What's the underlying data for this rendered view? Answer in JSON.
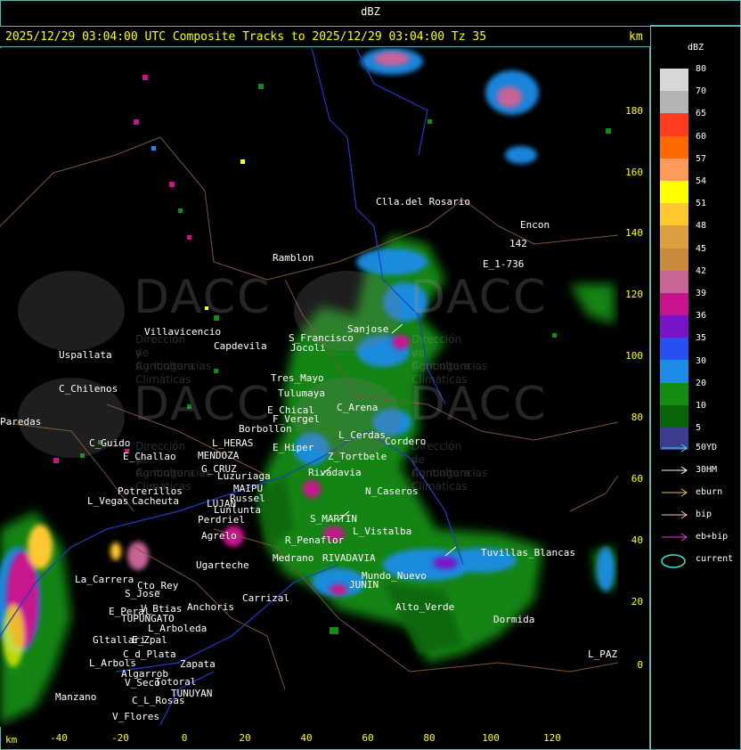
{
  "top_bar": {
    "title": "dBZ"
  },
  "header": {
    "text": "2025/12/29 03:04:00 UTC Composite Tracks to 2025/12/29 03:04:00 Tz 35",
    "unit": "km"
  },
  "axes": {
    "y_ticks": [
      "180",
      "160",
      "140",
      "120",
      "100",
      "80",
      "60",
      "40",
      "20",
      "0"
    ],
    "x_ticks": [
      "-40",
      "-20",
      "0",
      "20",
      "40",
      "60",
      "80",
      "100",
      "120"
    ],
    "x_unit": "km"
  },
  "legend": {
    "title": "dBZ",
    "scale": [
      {
        "label": "80",
        "color": "#d8d8d8"
      },
      {
        "label": "70",
        "color": "#b4b4b4"
      },
      {
        "label": "65",
        "color": "#ff3c1e"
      },
      {
        "label": "60",
        "color": "#ff6a00"
      },
      {
        "label": "57",
        "color": "#ff9a5a"
      },
      {
        "label": "54",
        "color": "#ffff00"
      },
      {
        "label": "51",
        "color": "#ffc830"
      },
      {
        "label": "48",
        "color": "#dca040"
      },
      {
        "label": "45",
        "color": "#c88c3c"
      },
      {
        "label": "42",
        "color": "#c86496"
      },
      {
        "label": "39",
        "color": "#c8148c"
      },
      {
        "label": "36",
        "color": "#7814c8"
      },
      {
        "label": "35",
        "color": "#2850f0"
      },
      {
        "label": "30",
        "color": "#1e8ce6"
      },
      {
        "label": "20",
        "color": "#148c14"
      },
      {
        "label": "10",
        "color": "#0a640a"
      },
      {
        "label": "5",
        "color": "#3c3c8c"
      }
    ],
    "tracks": [
      {
        "label": "50YD",
        "color": "#40e0e0"
      },
      {
        "label": "30HM",
        "color": "#ffffff"
      },
      {
        "label": "eburn",
        "color": "#e8c070"
      },
      {
        "label": "bip",
        "color": "#ffc0c0"
      },
      {
        "label": "eb+bip",
        "color": "#e040e0"
      },
      {
        "label": "current",
        "color": "#40e0e0"
      }
    ]
  },
  "watermark": {
    "brand": "DACC",
    "line1": "Dirección de Agricultura",
    "line2": "y Contingencias Climáticas"
  },
  "places": [
    {
      "name": "Clla.del Rosario"
    },
    {
      "name": "Encon"
    },
    {
      "name": "142"
    },
    {
      "name": "Ramblon"
    },
    {
      "name": "E_1-736"
    },
    {
      "name": "Villavicencio"
    },
    {
      "name": "Capdevila"
    },
    {
      "name": "S_Francisco"
    },
    {
      "name": "Jocoli"
    },
    {
      "name": "Sanjose"
    },
    {
      "name": "Uspallata"
    },
    {
      "name": "Tres_Mayo"
    },
    {
      "name": "Tulumaya"
    },
    {
      "name": "C_Chilenos"
    },
    {
      "name": "E_Chical"
    },
    {
      "name": "C_Arena"
    },
    {
      "name": "F_Vergel"
    },
    {
      "name": "Borbollon"
    },
    {
      "name": "L_Cerdas"
    },
    {
      "name": "Paredas"
    },
    {
      "name": "C_Guido"
    },
    {
      "name": "L_HERAS"
    },
    {
      "name": "E_Hiper"
    },
    {
      "name": "Z_Tortbele"
    },
    {
      "name": "Cordero"
    },
    {
      "name": "E_Challao"
    },
    {
      "name": "MENDOZA"
    },
    {
      "name": "G_CRUZ"
    },
    {
      "name": "Luzuriaga"
    },
    {
      "name": "Rivadavia"
    },
    {
      "name": "MAIPU"
    },
    {
      "name": "Russel"
    },
    {
      "name": "N_Caseros"
    },
    {
      "name": "Potrerillos"
    },
    {
      "name": "L_Vegas"
    },
    {
      "name": "Cacheuta"
    },
    {
      "name": "LUJAN"
    },
    {
      "name": "Lunlunta"
    },
    {
      "name": "S_MARTIN"
    },
    {
      "name": "Perdriel"
    },
    {
      "name": "Agrelo"
    },
    {
      "name": "L_Vistalba"
    },
    {
      "name": "R_Penaflor"
    },
    {
      "name": "Ugarteche"
    },
    {
      "name": "Medrano"
    },
    {
      "name": "RIVADAVIA"
    },
    {
      "name": "JUNIN"
    },
    {
      "name": "Mundo_Nuevo"
    },
    {
      "name": "Tuvillas_Blancas"
    },
    {
      "name": "La_Carrera"
    },
    {
      "name": "Cto_Rey"
    },
    {
      "name": "S_Jose"
    },
    {
      "name": "Carrizal"
    },
    {
      "name": "Alto_Verde"
    },
    {
      "name": "Anchoris"
    },
    {
      "name": "E_Peral"
    },
    {
      "name": "V_Btias"
    },
    {
      "name": "TUPUNGATO"
    },
    {
      "name": "L_Arboleda"
    },
    {
      "name": "Dormida"
    },
    {
      "name": "Gltallari"
    },
    {
      "name": "E_Zpal"
    },
    {
      "name": "C_d_Plata"
    },
    {
      "name": "L_Arbols"
    },
    {
      "name": "Zapata"
    },
    {
      "name": "Algarrob"
    },
    {
      "name": "V_Seco"
    },
    {
      "name": "Totoral"
    },
    {
      "name": "TUNUYAN"
    },
    {
      "name": "Manzano"
    },
    {
      "name": "C_L_Rosas"
    },
    {
      "name": "V_Flores"
    },
    {
      "name": "L_PAZ"
    }
  ]
}
